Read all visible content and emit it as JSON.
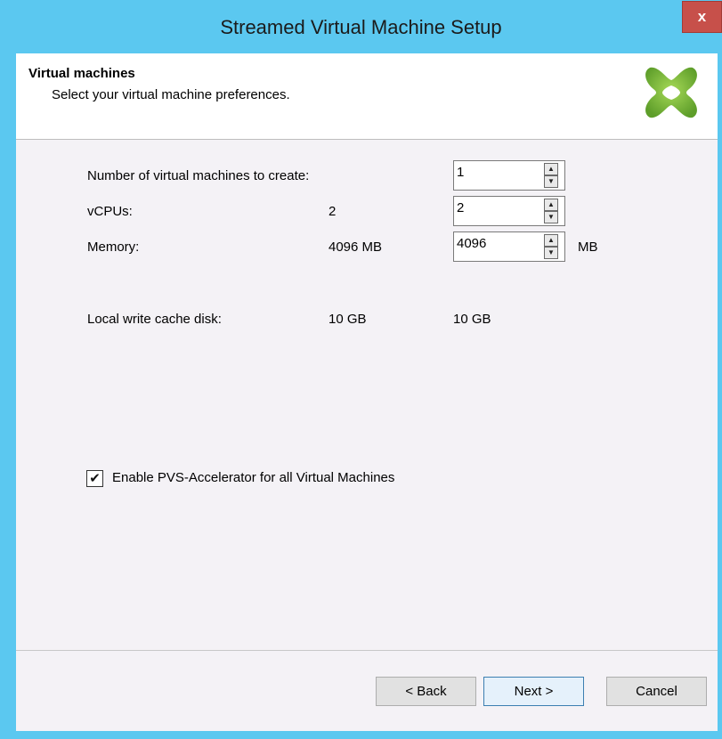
{
  "window": {
    "title": "Streamed Virtual Machine Setup",
    "close_label": "x"
  },
  "header": {
    "title": "Virtual machines",
    "subtitle": "Select your virtual machine preferences."
  },
  "form": {
    "vm_count": {
      "label": "Number of virtual machines to create:",
      "value": "1"
    },
    "vcpus": {
      "label": "vCPUs:",
      "default": "2",
      "value": "2"
    },
    "memory": {
      "label": "Memory:",
      "default": "4096 MB",
      "value": "4096",
      "unit": "MB"
    },
    "write_cache": {
      "label": "Local write cache disk:",
      "default": "10 GB",
      "value": "10 GB"
    },
    "pvs_accelerator": {
      "label": "Enable PVS-Accelerator for all Virtual Machines",
      "checked": true,
      "check_glyph": "✔"
    }
  },
  "spin_glyphs": {
    "up": "▲",
    "down": "▼"
  },
  "buttons": {
    "back": "< Back",
    "next": "Next >",
    "cancel": "Cancel"
  },
  "colors": {
    "titlebar": "#5bc8f0",
    "close": "#c7504a",
    "logo_green": "#7dc242"
  }
}
